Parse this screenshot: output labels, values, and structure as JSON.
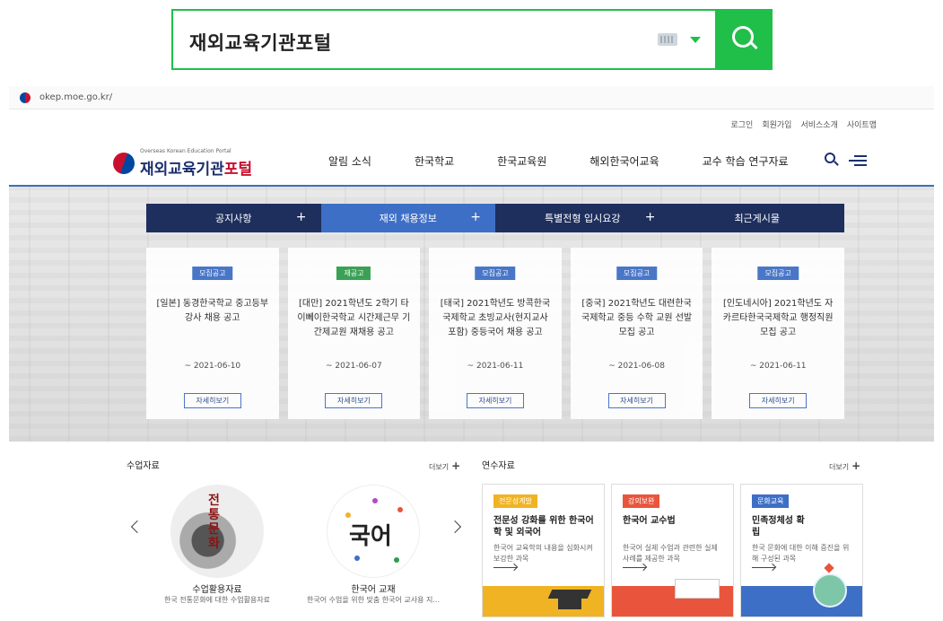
{
  "search": {
    "query": "재외교육기관포털"
  },
  "browser": {
    "url": "okep.moe.go.kr/"
  },
  "util_links": [
    "로그인",
    "회원가입",
    "서비스소개",
    "사이트맵"
  ],
  "logo": {
    "subtitle": "Overseas Korean Education Portal",
    "title_part1": "재외교육기관",
    "title_part2": "포털"
  },
  "nav": [
    "알림 소식",
    "한국학교",
    "한국교육원",
    "해외한국어교육",
    "교수 학습 연구자료"
  ],
  "tabs": [
    {
      "label": "공지사항",
      "plus": "+"
    },
    {
      "label": "재외 채용정보",
      "plus": "+"
    },
    {
      "label": "특별전형 입시요강",
      "plus": "+"
    },
    {
      "label": "최근게시물",
      "plus": ""
    }
  ],
  "cards": [
    {
      "badge": "모집공고",
      "title": "[일본] 동경한국학교 중고등부 강사 채용 공고",
      "date": "~ 2021-06-10",
      "button": "자세히보기",
      "badge_color": "#3e6fc6"
    },
    {
      "badge": "재공고",
      "title": "[대만] 2021학년도 2학기 타이뻬이한국학교 시간제근무 기간제교원 재채용 공고",
      "date": "~ 2021-06-07",
      "button": "자세히보기",
      "badge_color": "#2e9c4b"
    },
    {
      "badge": "모집공고",
      "title": "[태국] 2021학년도 방콕한국국제학교 초빙교사(현지교사 포함) 중등국어 채용 공고",
      "date": "~ 2021-06-11",
      "button": "자세히보기",
      "badge_color": "#3e6fc6"
    },
    {
      "badge": "모집공고",
      "title": "[중국] 2021학년도 대련한국국제학교 중등 수학 교원 선발 모집 공고",
      "date": "~ 2021-06-08",
      "button": "자세히보기",
      "badge_color": "#3e6fc6"
    },
    {
      "badge": "모집공고",
      "title": "[인도네시아] 2021학년도 자카르타한국국제학교 행정직원 모집 공고",
      "date": "~ 2021-06-11",
      "button": "자세히보기",
      "badge_color": "#3e6fc6"
    }
  ],
  "class_materials": {
    "title": "수업자료",
    "more": "더보기",
    "items": [
      {
        "circle_text": "전통문화",
        "label": "수업활용자료",
        "sub": "한국 전통문화에 대한 수업활용자료"
      },
      {
        "circle_text": "국어",
        "label": "한국어 교재",
        "sub": "한국어 수업을 위한 맞춤 한국어 교사용 지..."
      }
    ]
  },
  "training": {
    "title": "연수자료",
    "more": "더보기",
    "items": [
      {
        "badge": "전문성계발",
        "badge_color": "#f0b323",
        "title": "전문성 강화를 위한 한국어학 및 외국어",
        "desc": "한국어 교육학의 내용을 심화시켜 보강한 과목",
        "foot_color": "#f0b323"
      },
      {
        "badge": "강의보완",
        "badge_color": "#e9553c",
        "title": "한국어 교수법",
        "desc": "한국어 실제 수업과 관련한 실제 사례를 제공한 과목",
        "foot_color": "#e9553c"
      },
      {
        "badge": "문화교육",
        "badge_color": "#3e6fc6",
        "title": "민족정체성 확립",
        "desc": "한국 문화에 대한 이해 증진을 위해 구성된 과목",
        "foot_color": "#3e6fc6"
      }
    ]
  }
}
